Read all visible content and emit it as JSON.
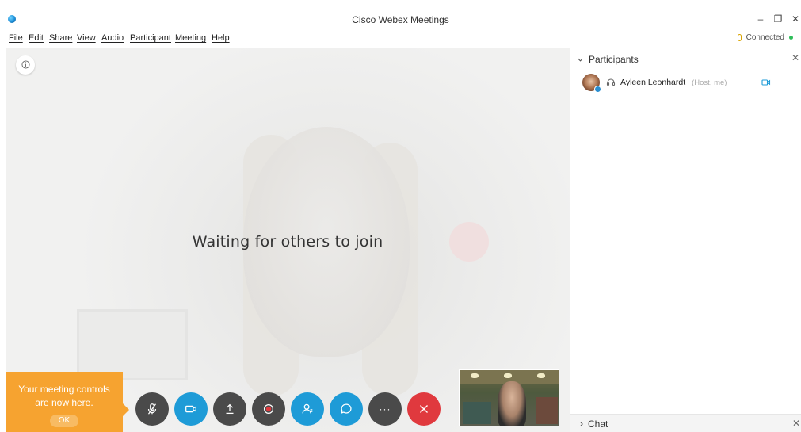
{
  "window": {
    "title": "Cisco Webex Meetings",
    "minimize": "–",
    "restore": "❐",
    "close": "✕"
  },
  "menu": [
    "File",
    "Edit",
    "Share",
    "View",
    "Audio",
    "Participant",
    "Meeting",
    "Help"
  ],
  "status": {
    "connection": "Connected",
    "color": "#2ebd59"
  },
  "stage": {
    "waiting_text": "Waiting for others to join",
    "info_icon": "info-icon"
  },
  "tooltip": {
    "line1": "Your meeting controls",
    "line2": "are now here.",
    "ok": "OK",
    "color": "#f6a330"
  },
  "controls": [
    {
      "name": "mute-button",
      "icon": "mic-off-icon",
      "color": "#4a4a4a"
    },
    {
      "name": "video-button",
      "icon": "video-camera-icon",
      "color": "#1e9bd7"
    },
    {
      "name": "share-button",
      "icon": "upload-icon",
      "color": "#4a4a4a"
    },
    {
      "name": "record-button",
      "icon": "record-icon",
      "color": "#4a4a4a"
    },
    {
      "name": "participants-button",
      "icon": "participants-icon",
      "color": "#1e9bd7"
    },
    {
      "name": "chat-button",
      "icon": "chat-icon",
      "color": "#1e9bd7"
    },
    {
      "name": "more-options-button",
      "icon": "ellipsis-icon",
      "color": "#4a4a4a",
      "label": "···"
    },
    {
      "name": "end-meeting-button",
      "icon": "close-icon",
      "color": "#e0393e"
    }
  ],
  "participants_panel": {
    "title": "Participants",
    "close": "✕",
    "list": [
      {
        "name": "Ayleen Leonhardt",
        "role": "(Host, me)"
      }
    ]
  },
  "chat_panel": {
    "title": "Chat",
    "close": "✕"
  }
}
